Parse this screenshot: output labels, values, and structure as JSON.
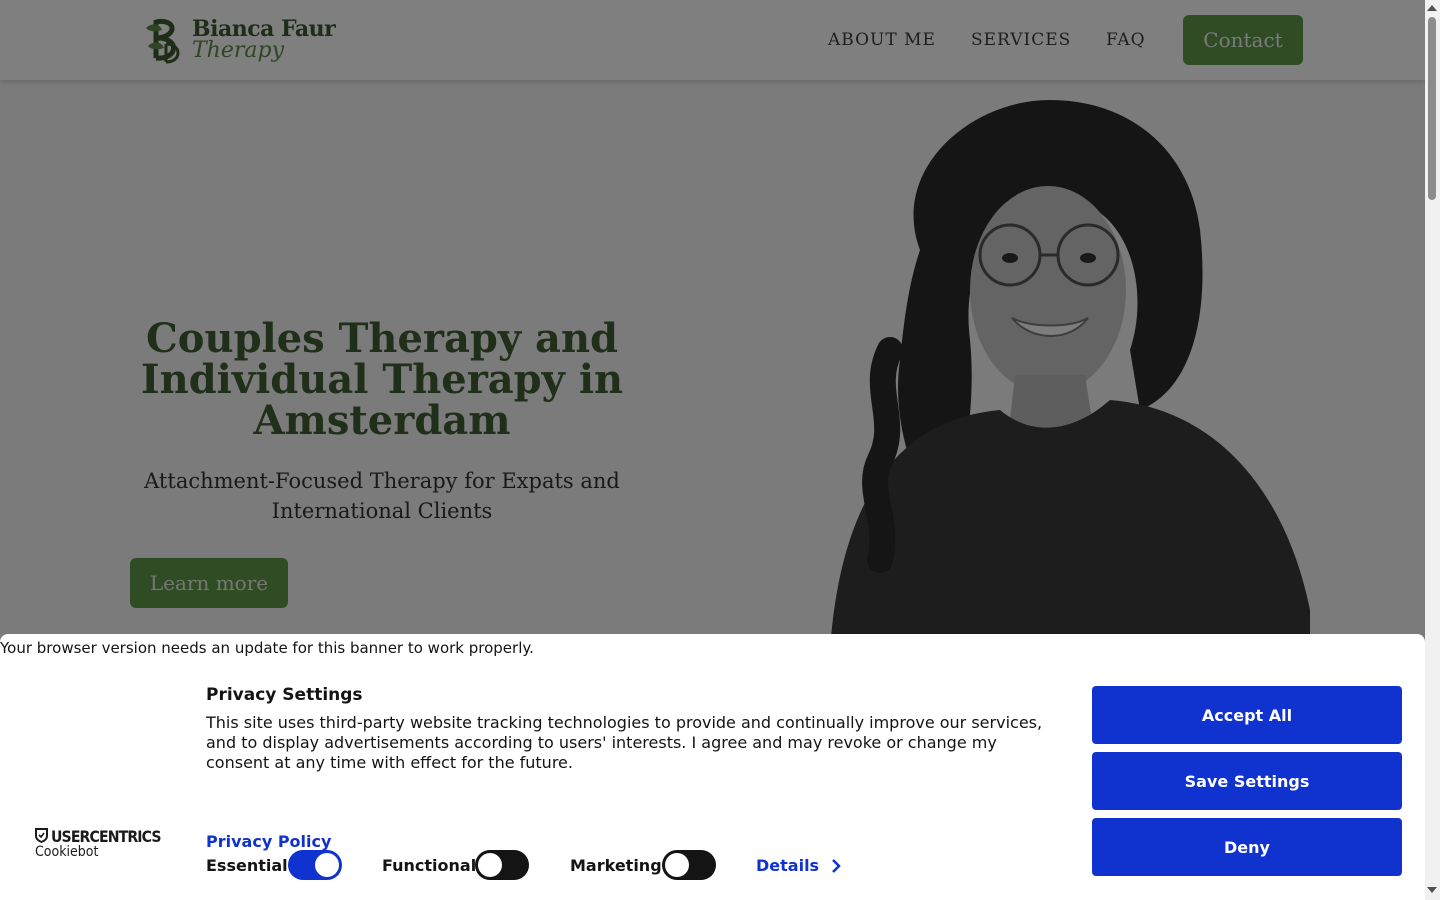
{
  "site": {
    "logo": {
      "name": "Bianca Faur",
      "sub": "Therapy"
    },
    "nav": [
      {
        "label": "ABOUT ME"
      },
      {
        "label": "SERVICES"
      },
      {
        "label": "FAQ"
      }
    ],
    "contact_label": "Contact",
    "hero": {
      "title": "Couples Therapy and Individual Therapy in Amsterdam",
      "subtitle": "Attachment-Focused Therapy for Expats and International Clients",
      "cta_label": "Learn more"
    }
  },
  "cookie_banner": {
    "update_notice": "Your browser version needs an update for this banner to work properly.",
    "brand": "USERCENTRICS",
    "product": "Cookiebot",
    "title": "Privacy Settings",
    "body": "This site uses third-party website tracking technologies to provide and continually improve our services, and to display advertisements according to users' interests. I agree and may revoke or change my consent at any time with effect for the future.",
    "privacy_policy_label": "Privacy Policy",
    "toggles": [
      {
        "label": "Essential",
        "enabled": true
      },
      {
        "label": "Functional",
        "enabled": false
      },
      {
        "label": "Marketing",
        "enabled": false
      }
    ],
    "details_label": "Details",
    "buttons": {
      "accept_all": "Accept All",
      "save_settings": "Save Settings",
      "deny": "Deny"
    }
  },
  "colors": {
    "brand_green": "#5f9948",
    "cookie_blue": "#1032cf"
  }
}
